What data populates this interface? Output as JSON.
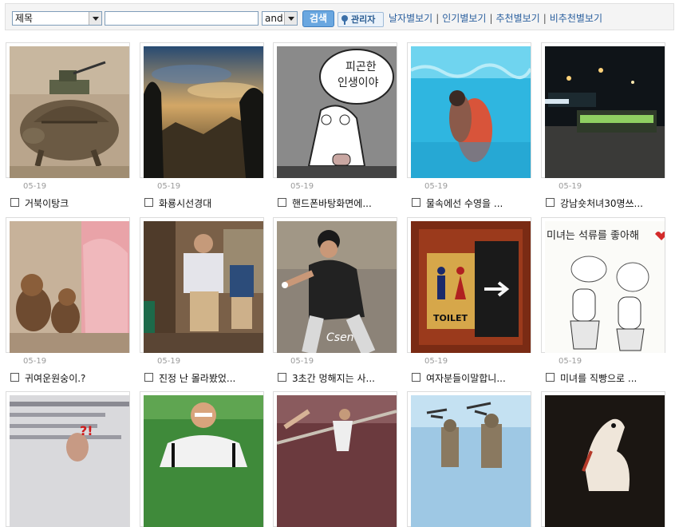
{
  "search": {
    "field_select": "제목",
    "query": "",
    "operator": "and",
    "button": "검색",
    "admin": "관리자"
  },
  "sort_links": [
    "날자별보기",
    "인기별보기",
    "추천별보기",
    "비추천별보기"
  ],
  "items": [
    {
      "date": "05-19",
      "title": "거북이탕크",
      "thumb": "tank-turtle"
    },
    {
      "date": "05-19",
      "title": "화룡시선경대",
      "thumb": "sunset-mountain"
    },
    {
      "date": "05-19",
      "title": "핸드폰바탕화면에...",
      "thumb": "cartoon-dog"
    },
    {
      "date": "05-19",
      "title": "물속에선 수영을 ...",
      "thumb": "underwater-swim"
    },
    {
      "date": "05-19",
      "title": "강남숏처녀30명쓰...",
      "thumb": "night-bus"
    },
    {
      "date": "05-19",
      "title": "귀여운원숭이.?",
      "thumb": "monkeys"
    },
    {
      "date": "05-19",
      "title": "진정 난 몰라봤었...",
      "thumb": "men-waiting"
    },
    {
      "date": "05-19",
      "title": "3초간 멍해지는 사...",
      "thumb": "baseball-pitcher"
    },
    {
      "date": "05-19",
      "title": "여자분들이말합니...",
      "thumb": "toilet-sign"
    },
    {
      "date": "05-19",
      "title": "미녀를 직빵으로 ...",
      "thumb": "cartoon-cards"
    },
    {
      "date": "",
      "title": "",
      "thumb": "newspaper"
    },
    {
      "date": "",
      "title": "",
      "thumb": "soccer-player"
    },
    {
      "date": "",
      "title": "",
      "thumb": "gymnast"
    },
    {
      "date": "",
      "title": "",
      "thumb": "sky-statues"
    },
    {
      "date": "",
      "title": "",
      "thumb": "white-horse"
    }
  ],
  "thumb_text": {
    "cartoon_bubble": [
      "피곤한",
      "인생이야"
    ],
    "toilet": "TOILET",
    "cards_title": "미녀는 석류를 좋아해",
    "pitcher_logo": "Csen",
    "news_marks": "?!"
  }
}
